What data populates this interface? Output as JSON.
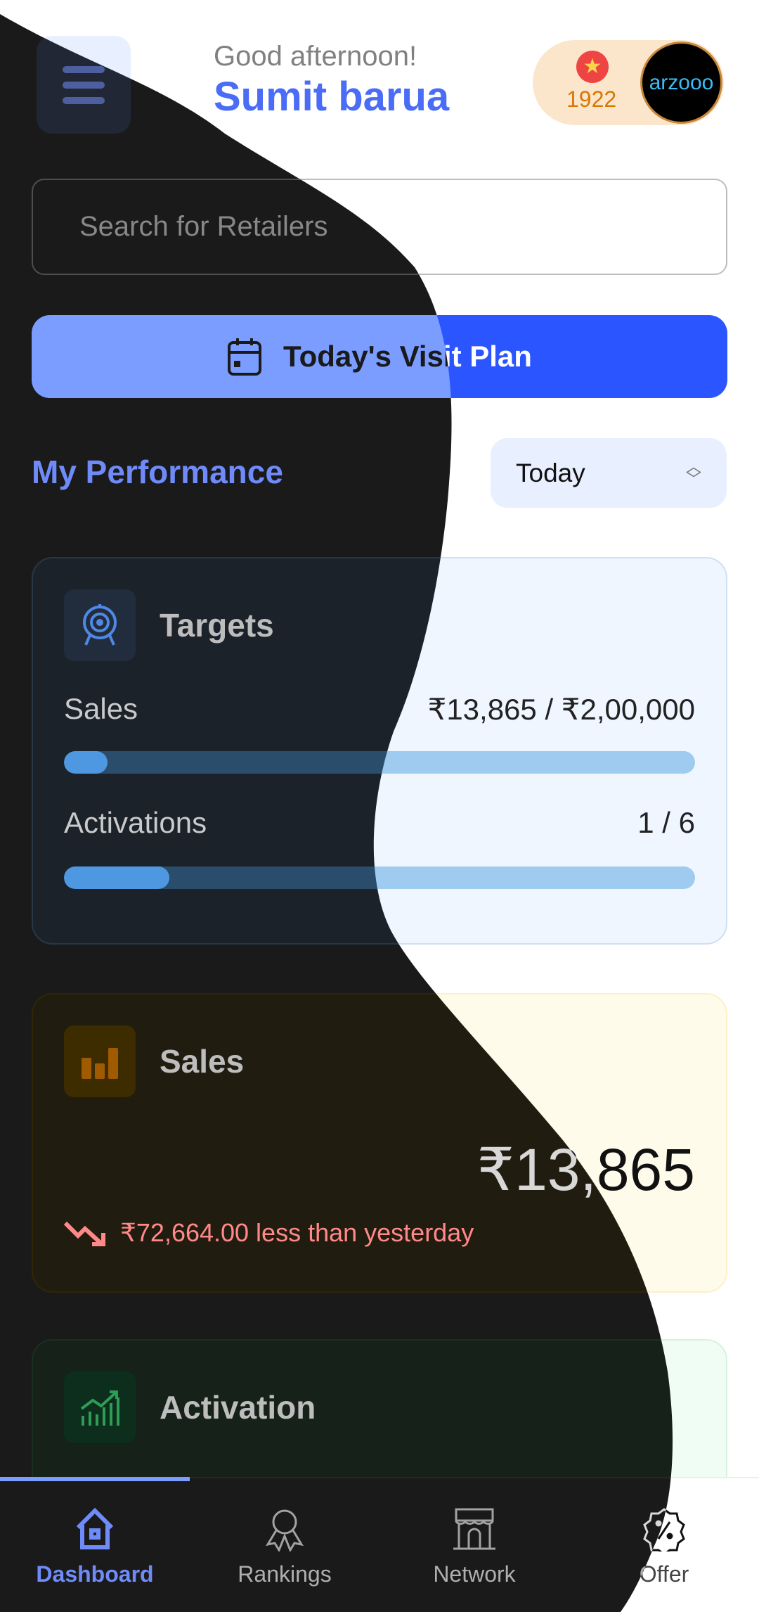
{
  "header": {
    "greeting": "Good afternoon!",
    "user_name": "Sumit barua",
    "points": "1922",
    "brand": "arzooo"
  },
  "search": {
    "placeholder": "Search for Retailers"
  },
  "visit_plan": {
    "label": "Today's Visit Plan"
  },
  "performance": {
    "title": "My Performance",
    "period": "Today"
  },
  "targets": {
    "title": "Targets",
    "sales_label": "Sales",
    "sales_value": "₹13,865 / ₹2,00,000",
    "sales_progress_pct": 6.9,
    "activations_label": "Activations",
    "activations_value": "1 / 6",
    "activations_progress_pct": 16.7
  },
  "sales": {
    "title": "Sales",
    "amount": "₹13,865",
    "trend": "₹72,664.00 less than yesterday"
  },
  "activation": {
    "title": "Activation"
  },
  "nav": [
    {
      "label": "Dashboard",
      "icon": "home-icon"
    },
    {
      "label": "Rankings",
      "icon": "ribbon-icon"
    },
    {
      "label": "Network",
      "icon": "store-icon"
    },
    {
      "label": "Offer",
      "icon": "discount-icon"
    }
  ],
  "colors": {
    "accent": "#4a6cf7",
    "button": "#2a55ff",
    "negative": "#dc2626",
    "points": "#d97706"
  }
}
